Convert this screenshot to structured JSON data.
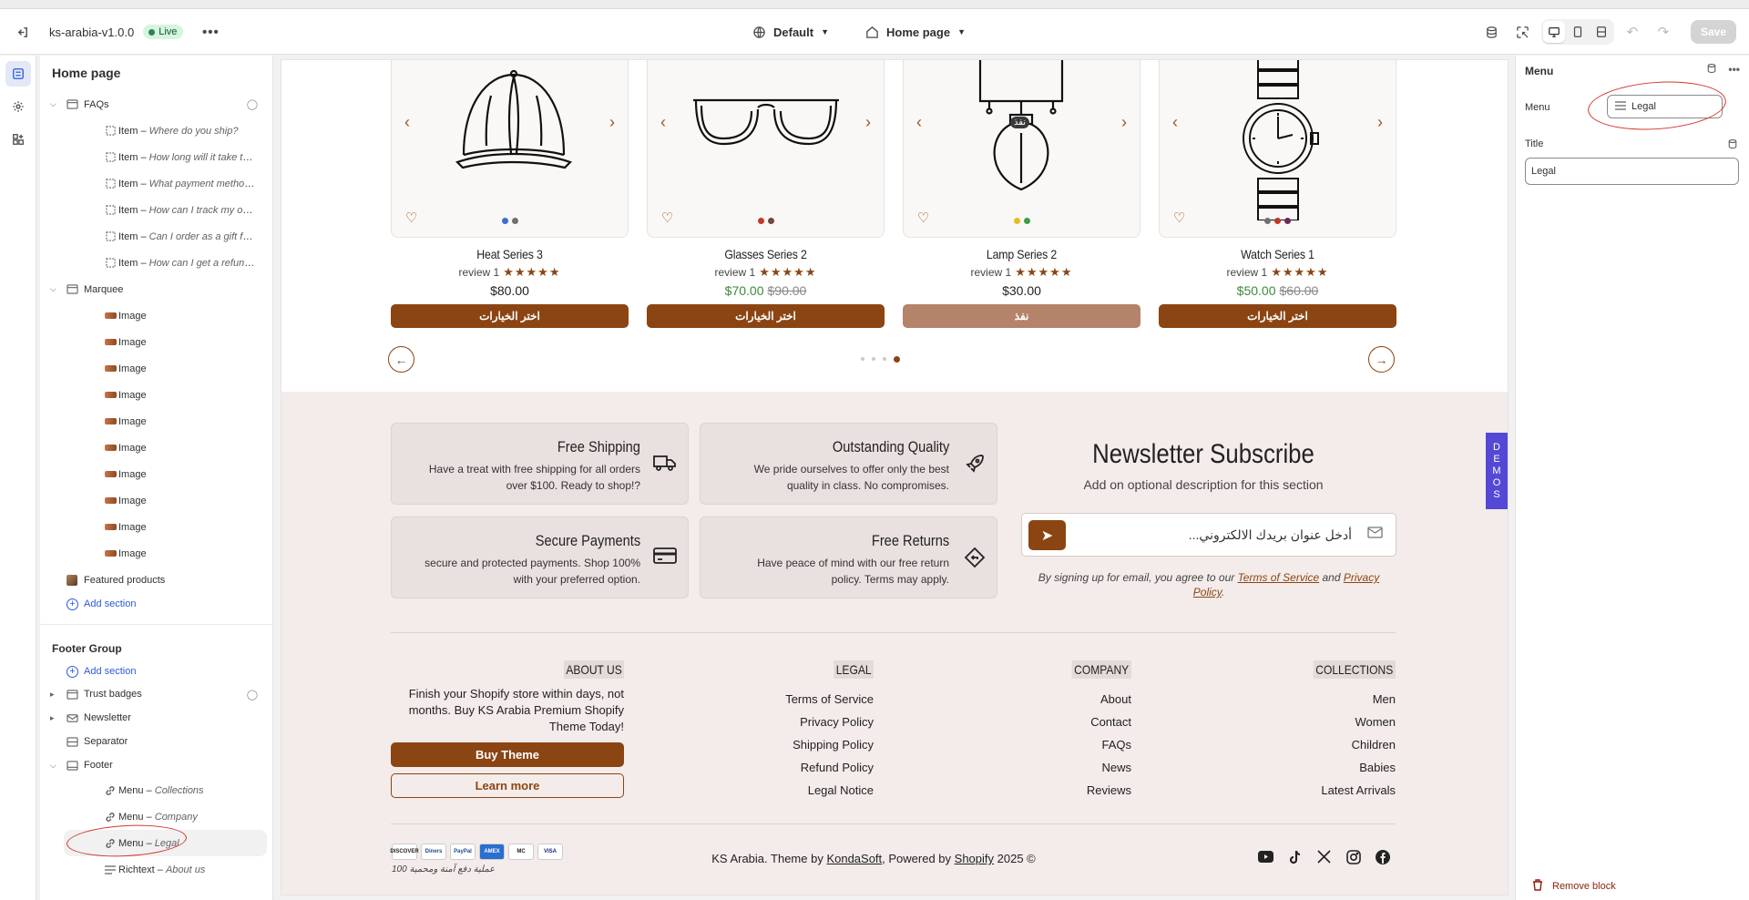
{
  "topbar": {
    "theme_name": "ks-arabia-v1.0.0",
    "live_label": "Live",
    "template_label": "Default",
    "page_label": "Home page",
    "save_label": "Save"
  },
  "left_panel": {
    "title": "Home page",
    "faqs": {
      "label": "FAQs",
      "items": [
        {
          "prefix": "Item – ",
          "text": "Where do you ship?"
        },
        {
          "prefix": "Item – ",
          "text": "How long will it take to recei..."
        },
        {
          "prefix": "Item – ",
          "text": "What payment methods do ..."
        },
        {
          "prefix": "Item – ",
          "text": "How can I track my order?"
        },
        {
          "prefix": "Item – ",
          "text": "Can I order as a gift for som..."
        },
        {
          "prefix": "Item – ",
          "text": "How can I get a refund for m..."
        }
      ]
    },
    "marquee": {
      "label": "Marquee",
      "items": [
        "Image",
        "Image",
        "Image",
        "Image",
        "Image",
        "Image",
        "Image",
        "Image",
        "Image",
        "Image"
      ]
    },
    "featured_products": "Featured products",
    "add_section": "Add section",
    "footer_group": {
      "title": "Footer Group",
      "add_section": "Add section",
      "trust_badges": "Trust badges",
      "newsletter": "Newsletter",
      "separator": "Separator",
      "footer": "Footer",
      "footer_items": [
        {
          "prefix": "Menu – ",
          "text": "Collections",
          "icon": "link-icon"
        },
        {
          "prefix": "Menu – ",
          "text": "Company",
          "icon": "link-icon"
        },
        {
          "prefix": "Menu – ",
          "text": "Legal",
          "icon": "link-icon"
        },
        {
          "prefix": "Richtext – ",
          "text": "About us",
          "icon": "text-icon"
        }
      ]
    }
  },
  "products": [
    {
      "name": "Heat Series 3",
      "review": "review 1",
      "price": "$80.00",
      "compare": "",
      "button": "اختر الخيارات",
      "sold_out": false,
      "dots": [
        "#3a6fd8",
        "#707070"
      ]
    },
    {
      "name": "Glasses Series 2",
      "review": "review 1",
      "price": "$70.00",
      "compare": "$90.00",
      "button": "اختر الخيارات",
      "sold_out": false,
      "dots": [
        "#c0392b",
        "#6e4a3a"
      ]
    },
    {
      "name": "Lamp Series 2",
      "review": "review 1",
      "price": "$30.00",
      "compare": "",
      "button": "نفذ",
      "sold_out": true,
      "badge": "نفذ",
      "dots": [
        "#e0c020",
        "#3aa048"
      ]
    },
    {
      "name": "Watch Series 1",
      "review": "review 1",
      "price": "$50.00",
      "compare": "$60.00",
      "button": "اختر الخيارات",
      "sold_out": false,
      "dots": [
        "#707070",
        "#c0392b",
        "#6a2a5a"
      ]
    }
  ],
  "trust": [
    {
      "title": "Free Shipping",
      "desc": "Have a treat with free shipping for all orders over $100. Ready to shop!?",
      "icon": "truck-icon"
    },
    {
      "title": "Outstanding Quality",
      "desc": "We pride ourselves to offer only the best quality in class. No compromises.",
      "icon": "rocket-icon"
    },
    {
      "title": "Secure Payments",
      "desc": "secure and protected payments. Shop 100% with your preferred option.",
      "icon": "card-icon"
    },
    {
      "title": "Free Returns",
      "desc": "Have peace of mind with our free return policy. Terms may apply.",
      "icon": "return-icon"
    }
  ],
  "newsletter": {
    "title": "Newsletter Subscribe",
    "desc": "Add on optional description for this section",
    "placeholder": "أدخل عنوان بريدك الالكتروني...",
    "legal_prefix": "By signing up for email, you agree to our ",
    "tos": "Terms of Service",
    "and": " and ",
    "privacy": "Privacy Policy",
    "legal_suffix": "."
  },
  "demos_tab": "DEMOS",
  "footer": {
    "about": {
      "heading": "ABOUT US",
      "text": "Finish your Shopify store within days, not months. Buy KS Arabia Premium Shopify Theme Today!",
      "buy_button": "Buy Theme",
      "learn_button": "Learn more"
    },
    "legal": {
      "heading": "LEGAL",
      "links": [
        "Terms of Service",
        "Privacy Policy",
        "Shipping Policy",
        "Refund Policy",
        "Legal Notice"
      ]
    },
    "company": {
      "heading": "COMPANY",
      "links": [
        "About",
        "Contact",
        "FAQs",
        "News",
        "Reviews"
      ]
    },
    "collections": {
      "heading": "COLLECTIONS",
      "links": [
        "Men",
        "Women",
        "Children",
        "Babies",
        "Latest Arrivals"
      ]
    },
    "payments": [
      "DISCOVER",
      "Diners",
      "PayPal",
      "AMEX",
      "MC",
      "VISA"
    ],
    "payments_note": "100 عملية دفع آمنة ومحمية",
    "copyright_pre": "KS Arabia. Theme by ",
    "kondasoft": "KondaSoft",
    "copyright_mid": ", Powered by ",
    "shopify": "Shopify",
    "copyright_post": " 2025 ©",
    "socials": [
      "youtube-icon",
      "tiktok-icon",
      "x-icon",
      "instagram-icon",
      "facebook-icon"
    ]
  },
  "right_panel": {
    "title": "Menu",
    "menu_label": "Menu",
    "menu_value": "Legal",
    "title_label": "Title",
    "title_value": "Legal",
    "remove_block": "Remove block"
  },
  "colors": {
    "brand": "#8b4513",
    "footer_bg": "#f3ecea",
    "link": "#2a5bd7",
    "danger": "#8e1f0b"
  }
}
